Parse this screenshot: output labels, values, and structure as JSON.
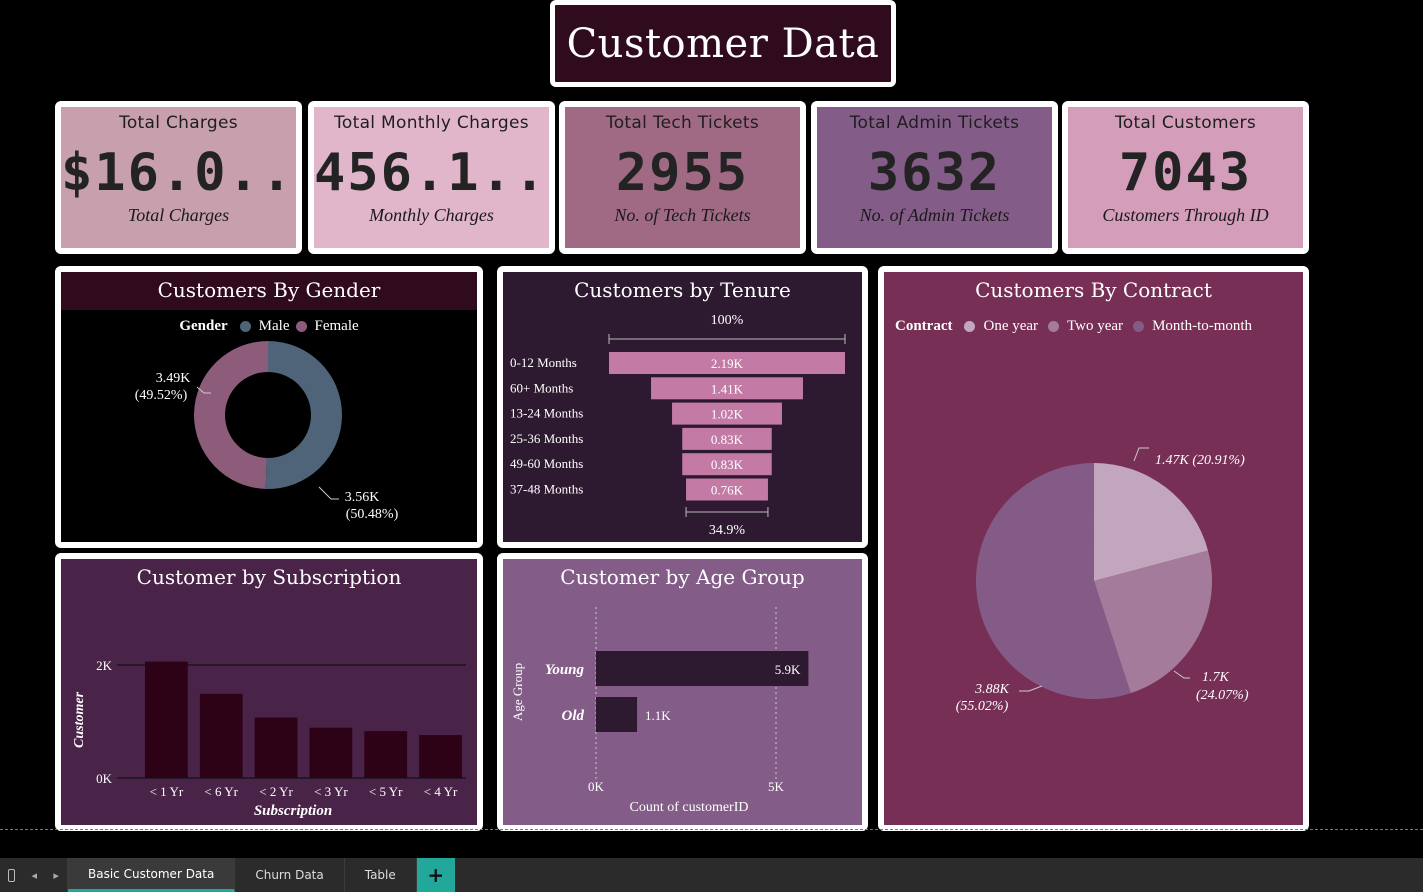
{
  "report_title": "Customer Data",
  "kpis": [
    {
      "title": "Total Charges",
      "value": "$16.0...",
      "subtitle": "Total Charges",
      "bg": "#c89fad"
    },
    {
      "title": "Total Monthly Charges",
      "value": "456.1...",
      "subtitle": "Monthly Charges",
      "bg": "#e1b6cb"
    },
    {
      "title": "Total Tech Tickets",
      "value": "2955",
      "subtitle": "No. of Tech Tickets",
      "bg": "#a06a84"
    },
    {
      "title": "Total Admin Tickets",
      "value": "3632",
      "subtitle": "No. of Admin Tickets",
      "bg": "#835d88"
    },
    {
      "title": "Total Customers",
      "value": "7043",
      "subtitle": "Customers Through ID",
      "bg": "#d49ebb"
    }
  ],
  "gender": {
    "title": "Customers By Gender",
    "legend_title": "Gender",
    "legend": [
      "Male",
      "Female"
    ],
    "colors": {
      "male": "#4f6478",
      "female": "#8d5c7a"
    },
    "labels": {
      "female_value": "3.49K",
      "female_pct": "(49.52%)",
      "male_value": "3.56K",
      "male_pct": "(50.48%)"
    }
  },
  "tenure": {
    "title": "Customers by Tenure",
    "top_label": "100%",
    "bottom_label": "34.9%",
    "bar_color": "#c37aa4"
  },
  "contract": {
    "title": "Customers By Contract",
    "legend_title": "Contract",
    "legend": [
      "One year",
      "Two year",
      "Month-to-month"
    ],
    "colors": {
      "one_year": "#c1a6bd",
      "two_year": "#a47b9b",
      "month": "#845b86"
    },
    "labels": {
      "one_year": "1.47K (20.91%)",
      "two_year_value": "1.7K",
      "two_year_pct": "(24.07%)",
      "month_value": "3.88K",
      "month_pct": "(55.02%)"
    }
  },
  "subscription": {
    "title": "Customer by Subscription",
    "bar_color": "#2d0217"
  },
  "agegroup": {
    "title": "Customer by Age Group",
    "bar_color": "#2e1a30"
  },
  "tabs": {
    "nav": [
      "◂",
      "▸"
    ],
    "items": [
      "Basic Customer Data",
      "Churn Data",
      "Table"
    ],
    "add": "+"
  },
  "chart_data": [
    {
      "type": "pie",
      "title": "Customers By Gender",
      "categories": [
        "Male",
        "Female"
      ],
      "values": [
        3560,
        3490
      ],
      "percent": [
        50.48,
        49.52
      ],
      "legend": "top"
    },
    {
      "type": "bar",
      "title": "Customers by Tenure",
      "orientation": "horizontal",
      "categories": [
        "0-12 Months",
        "60+ Months",
        "13-24 Months",
        "25-36 Months",
        "49-60 Months",
        "37-48 Months"
      ],
      "values": [
        2190,
        1410,
        1020,
        830,
        830,
        760
      ],
      "value_labels": [
        "2.19K",
        "1.41K",
        "1.02K",
        "0.83K",
        "0.83K",
        "0.76K"
      ]
    },
    {
      "type": "pie",
      "title": "Customers By Contract",
      "categories": [
        "One year",
        "Two year",
        "Month-to-month"
      ],
      "values": [
        1470,
        1700,
        3880
      ],
      "percent": [
        20.91,
        24.07,
        55.02
      ],
      "legend": "top"
    },
    {
      "type": "bar",
      "title": "Customer by Subscription",
      "categories": [
        "< 1 Yr",
        "< 6 Yr",
        "< 2 Yr",
        "< 3 Yr",
        "< 5 Yr",
        "< 4 Yr"
      ],
      "values": [
        2060,
        1490,
        1070,
        890,
        830,
        760
      ],
      "xlabel": "Subscription",
      "ylabel": "Customer",
      "yticks": [
        "0K",
        "2K"
      ],
      "ylim": [
        0,
        2100
      ],
      "grid": true
    },
    {
      "type": "bar",
      "title": "Customer by Age Group",
      "orientation": "horizontal",
      "categories": [
        "Young",
        "Old"
      ],
      "values": [
        5900,
        1140
      ],
      "value_labels": [
        "5.9K",
        "1.1K"
      ],
      "xlabel": "Count of customerID",
      "ylabel": "Age Group",
      "xticks": [
        "0K",
        "5K"
      ],
      "xlim": [
        0,
        5000
      ]
    }
  ]
}
